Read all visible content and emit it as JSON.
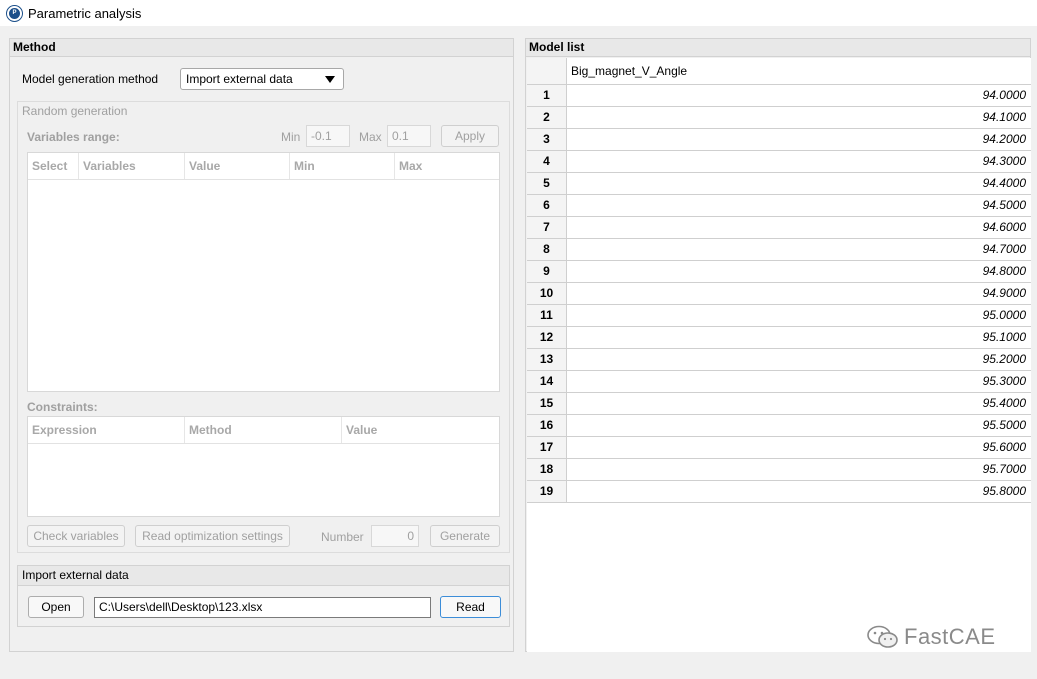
{
  "window": {
    "title": "Parametric analysis"
  },
  "method": {
    "header": "Method",
    "generation_label": "Model generation method",
    "generation_value": "Import external data",
    "random": {
      "title": "Random generation",
      "variables_range_label": "Variables range:",
      "min_label": "Min",
      "min_value": "-0.1",
      "max_label": "Max",
      "max_value": "0.1",
      "apply_label": "Apply",
      "columns": [
        "Select",
        "Variables",
        "Value",
        "Min",
        "Max"
      ],
      "constraints_label": "Constraints:",
      "constraint_columns": [
        "Expression",
        "Method",
        "Value"
      ],
      "check_variables_label": "Check variables",
      "read_optimization_label": "Read optimization settings",
      "number_label": "Number",
      "number_value": "0",
      "generate_label": "Generate"
    },
    "import": {
      "header": "Import external data",
      "open_label": "Open",
      "path_value": "C:\\Users\\dell\\Desktop\\123.xlsx",
      "read_label": "Read"
    }
  },
  "model_list": {
    "header": "Model list",
    "column": "Big_magnet_V_Angle",
    "rows": [
      {
        "num": "1",
        "value": "94.0000"
      },
      {
        "num": "2",
        "value": "94.1000"
      },
      {
        "num": "3",
        "value": "94.2000"
      },
      {
        "num": "4",
        "value": "94.3000"
      },
      {
        "num": "5",
        "value": "94.4000"
      },
      {
        "num": "6",
        "value": "94.5000"
      },
      {
        "num": "7",
        "value": "94.6000"
      },
      {
        "num": "8",
        "value": "94.7000"
      },
      {
        "num": "9",
        "value": "94.8000"
      },
      {
        "num": "10",
        "value": "94.9000"
      },
      {
        "num": "11",
        "value": "95.0000"
      },
      {
        "num": "12",
        "value": "95.1000"
      },
      {
        "num": "13",
        "value": "95.2000"
      },
      {
        "num": "14",
        "value": "95.3000"
      },
      {
        "num": "15",
        "value": "95.4000"
      },
      {
        "num": "16",
        "value": "95.5000"
      },
      {
        "num": "17",
        "value": "95.6000"
      },
      {
        "num": "18",
        "value": "95.7000"
      },
      {
        "num": "19",
        "value": "95.8000"
      }
    ]
  },
  "watermark": {
    "text": "FastCAE"
  }
}
